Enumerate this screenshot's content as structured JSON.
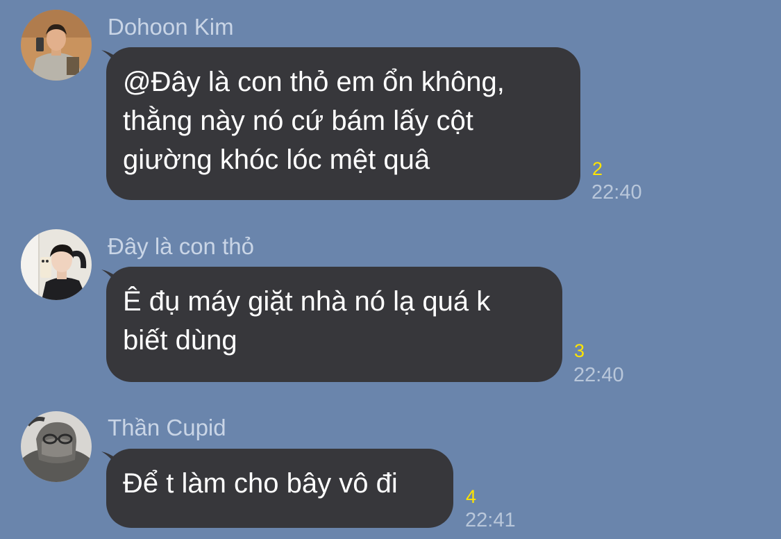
{
  "messages": [
    {
      "sender": "Dohoon Kim",
      "text": "@Đây là con thỏ em ổn không,\nthằng này nó cứ bám lấy cột\ngiường khóc lóc mệt quâ",
      "unread": "2",
      "time": "22:40"
    },
    {
      "sender": "Đây là con thỏ",
      "text": "Ê đụ máy giặt nhà nó lạ quá k\nbiết dùng",
      "unread": "3",
      "time": "22:40"
    },
    {
      "sender": "Thần Cupid",
      "text": "Để t làm cho bây vô đi",
      "unread": "4",
      "time": "22:41"
    }
  ],
  "colors": {
    "background": "#6a85ac",
    "bubble": "#37373b",
    "unread": "#ffe400",
    "time": "#b9c7da",
    "sender": "#c9d5e6"
  }
}
